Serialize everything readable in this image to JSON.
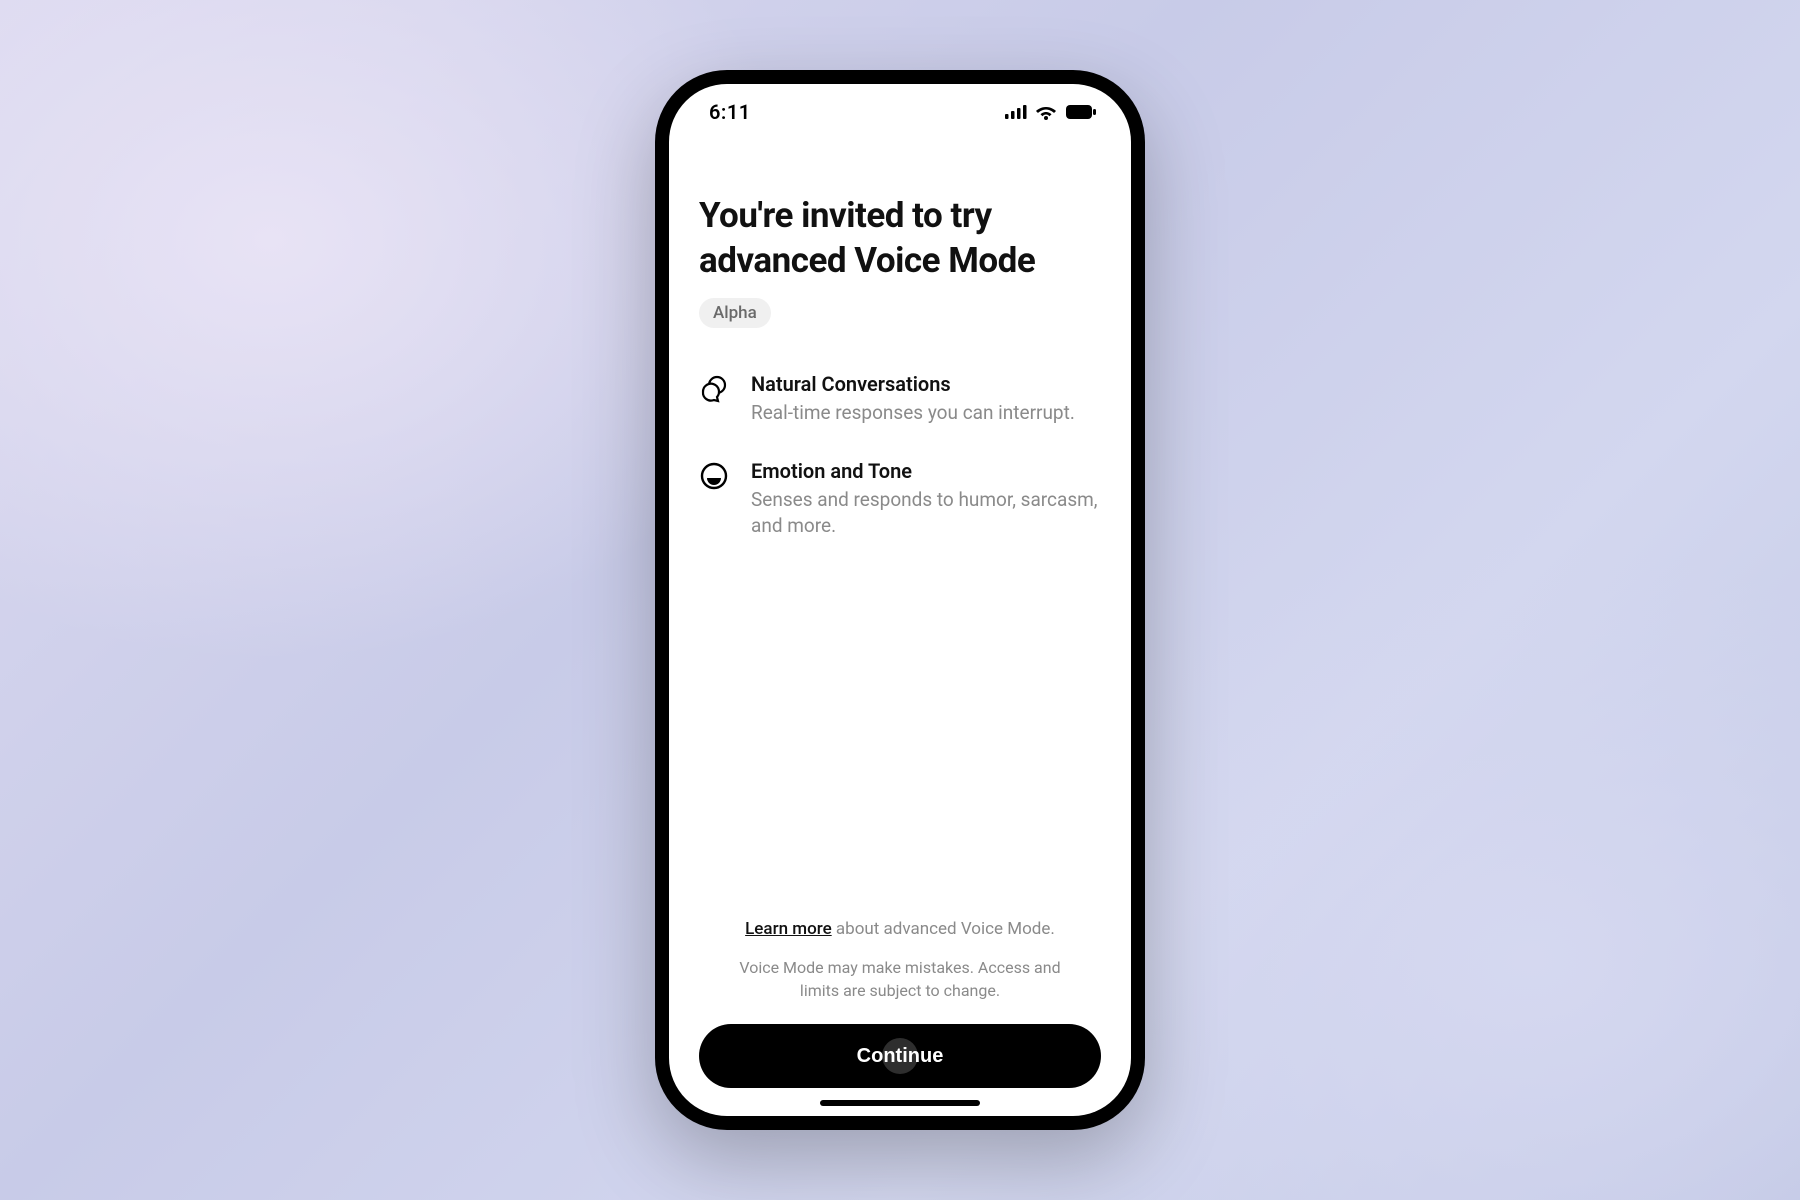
{
  "status": {
    "time": "6:11"
  },
  "title": "You're invited to try advanced Voice Mode",
  "badge": "Alpha",
  "features": [
    {
      "title": "Natural Conversations",
      "desc": "Real-time responses you can interrupt."
    },
    {
      "title": "Emotion and Tone",
      "desc": "Senses and responds to humor, sarcasm, and more."
    }
  ],
  "footer": {
    "learn_more": "Learn more",
    "learn_more_suffix": " about advanced Voice Mode.",
    "disclaimer": "Voice Mode may make mistakes. Access and limits are subject to change."
  },
  "cta": "Continue"
}
